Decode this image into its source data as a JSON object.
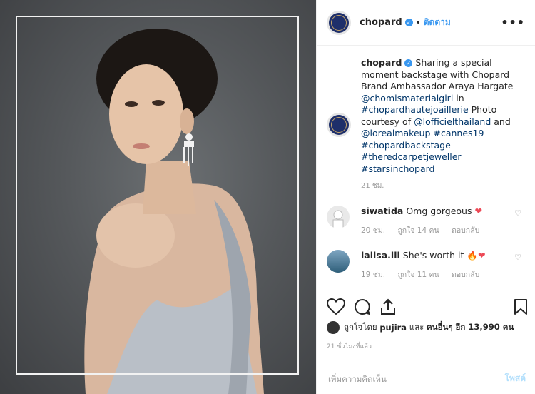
{
  "header": {
    "username": "chopard",
    "dot": "•",
    "follow_label": "ติดตาม",
    "more_label": "•••"
  },
  "caption": {
    "username": "chopard",
    "text_1": "Sharing a special moment backstage with Chopard Brand Ambassador Araya Hargate",
    "mention_1": "@chomismaterialgirl",
    "in": "in",
    "hashtag_1": "#chopardhautejoaillerie",
    "text_2": "Photo courtesy of",
    "mention_2": "@lofficielthailand",
    "and": "and",
    "mention_3": "@lorealmakeup",
    "hashtag_2": "#cannes19",
    "hashtag_3": "#chopardbackstage",
    "hashtag_4": "#theredcarpetjeweller",
    "hashtag_5": "#starsinchopard",
    "time": "21 ชม."
  },
  "comments": [
    {
      "username": "siwatida",
      "text": "Omg gorgeous",
      "emoji": "❤",
      "time": "20 ชม.",
      "likes": "ถูกใจ 14 คน",
      "reply": "ตอบกลับ"
    },
    {
      "username": "lalisa.lll",
      "text": "She's worth it",
      "emoji": "🔥❤",
      "time": "19 ชม.",
      "likes": "ถูกใจ 11 คน",
      "reply": "ตอบกลับ"
    }
  ],
  "likes": {
    "prefix": "ถูกใจโดย",
    "user": "pujira",
    "middle": "และ",
    "others": "คนอื่นๆ อีก 13,990 คน"
  },
  "posted": "21 ชั่วโมงที่แล้ว",
  "add_comment": {
    "placeholder": "เพิ่มความคิดเห็น",
    "post_label": "โพสต์"
  },
  "colors": {
    "link": "#003569",
    "accent": "#3897f0",
    "heart": "#ed4956"
  }
}
